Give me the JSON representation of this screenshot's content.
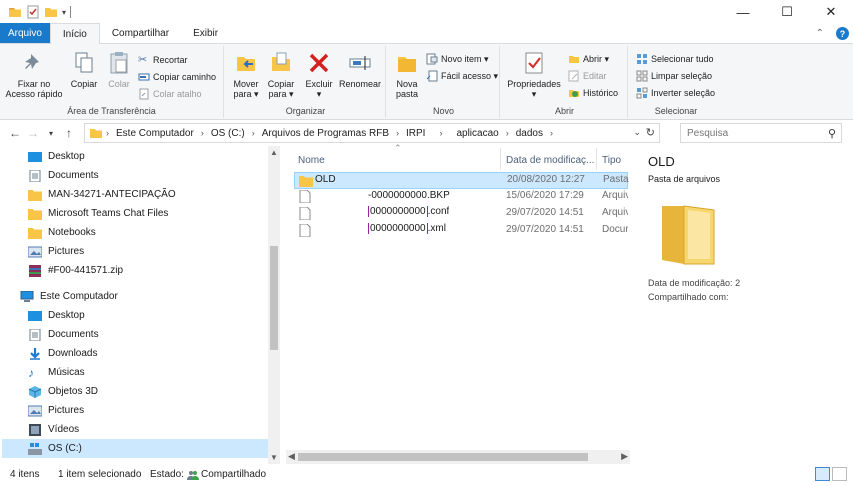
{
  "titlebar": {
    "title": "",
    "minimize": "—",
    "maximize": "☐",
    "close": "✕"
  },
  "tabs": [
    {
      "label": "Arquivo"
    },
    {
      "label": "Início"
    },
    {
      "label": "Compartilhar"
    },
    {
      "label": "Exibir"
    }
  ],
  "ribbon": {
    "clipboard": {
      "group_label": "Área de Transferência",
      "pin_label_1": "Fixar no",
      "pin_label_2": "Acesso rápido",
      "copy": "Copiar",
      "paste": "Colar",
      "cut": "Recortar",
      "copy_path": "Copiar caminho",
      "paste_shortcut": "Colar atalho"
    },
    "organize": {
      "group_label": "Organizar",
      "move_1": "Mover",
      "move_2": "para ▾",
      "copyto_1": "Copiar",
      "copyto_2": "para ▾",
      "delete_1": "Excluir",
      "delete_2": "▾",
      "rename": "Renomear"
    },
    "new": {
      "group_label": "Novo",
      "new_folder_1": "Nova",
      "new_folder_2": "pasta",
      "new_item": "Novo item ▾",
      "easy_access": "Fácil acesso ▾"
    },
    "open": {
      "group_label": "Abrir",
      "properties": "Propriedades",
      "properties_2": "▾",
      "open": "Abrir ▾",
      "edit": "Editar",
      "history": "Histórico"
    },
    "select": {
      "group_label": "Selecionar",
      "select_all": "Selecionar tudo",
      "select_none": "Limpar seleção",
      "invert": "Inverter seleção"
    }
  },
  "address": {
    "crumbs": [
      "Este Computador",
      "OS (C:)",
      "Arquivos de Programas RFB",
      "IRPI",
      "aplicacao",
      "dados"
    ],
    "search_placeholder": "Pesquisa"
  },
  "navpane": {
    "quick_items": [
      {
        "label": "Desktop"
      },
      {
        "label": "Documents"
      },
      {
        "label": "MAN-34271-ANTECIPAÇÃO"
      },
      {
        "label": "Microsoft Teams Chat Files"
      },
      {
        "label": "Notebooks"
      },
      {
        "label": "Pictures"
      },
      {
        "label": "#F00-441571.zip"
      }
    ],
    "pc_label": "Este Computador",
    "pc_items": [
      {
        "label": "Desktop"
      },
      {
        "label": "Documents"
      },
      {
        "label": "Downloads"
      },
      {
        "label": "Músicas"
      },
      {
        "label": "Objetos 3D"
      },
      {
        "label": "Pictures"
      },
      {
        "label": "Vídeos"
      },
      {
        "label": "OS (C:)"
      }
    ]
  },
  "filelist": {
    "columns": {
      "name": "Nome",
      "date": "Data de modificaç...",
      "type": "Tipo"
    },
    "rows": [
      {
        "name": "OLD",
        "date": "20/08/2020 12:27",
        "type": "Pasta"
      },
      {
        "name": "-0000000000.BKP",
        "date": "15/06/2020 17:29",
        "type": "Arquiv"
      },
      {
        "name_redacted": "0000000000",
        "name_ext": ".conf",
        "date": "29/07/2020 14:51",
        "type": "Arquiv"
      },
      {
        "name_redacted": "0000000000",
        "name_ext": ".xml",
        "date": "29/07/2020 14:51",
        "type": "Docur"
      }
    ]
  },
  "preview": {
    "title": "OLD",
    "type": "Pasta de arquivos",
    "modified_label": "Data de modificação:",
    "modified_value": "2",
    "shared_label": "Compartilhado com:"
  },
  "status": {
    "count": "4 itens",
    "selected": "1 item selecionado",
    "state_label": "Estado:",
    "state_value": "Compartilhado"
  }
}
